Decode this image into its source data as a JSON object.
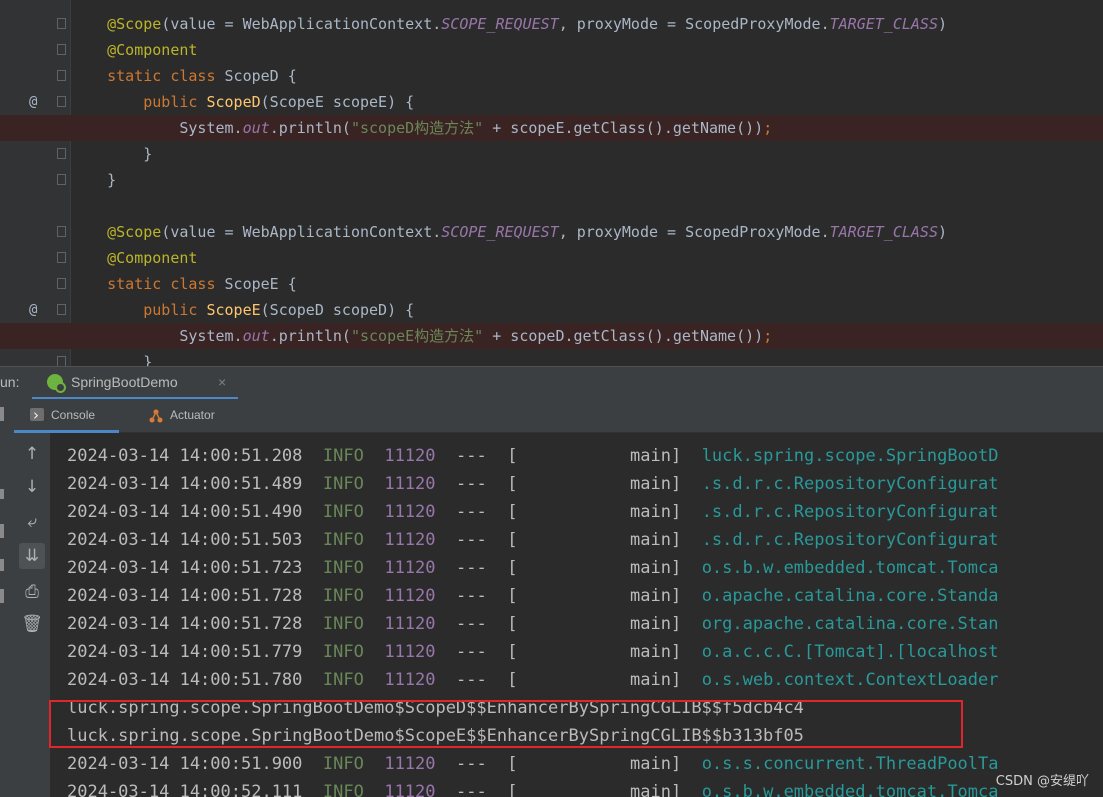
{
  "editor": {
    "lines": [
      {
        "gutter": "",
        "breakpoint": false,
        "segments": [
          {
            "c": "k-plain",
            "t": "    "
          },
          {
            "c": "k-ann",
            "t": "@Scope"
          },
          {
            "c": "k-plain",
            "t": "(value = WebApplicationContext."
          },
          {
            "c": "k-st",
            "t": "SCOPE_REQUEST"
          },
          {
            "c": "k-plain",
            "t": ", proxyMode = ScopedProxyMode."
          },
          {
            "c": "k-st",
            "t": "TARGET_CLASS"
          },
          {
            "c": "k-plain",
            "t": ")"
          }
        ]
      },
      {
        "gutter": "",
        "breakpoint": false,
        "segments": [
          {
            "c": "k-plain",
            "t": "    "
          },
          {
            "c": "k-ann",
            "t": "@Component"
          }
        ]
      },
      {
        "gutter": "",
        "breakpoint": false,
        "segments": [
          {
            "c": "k-plain",
            "t": "    "
          },
          {
            "c": "k-kw",
            "t": "static class "
          },
          {
            "c": "k-plain",
            "t": "ScopeD {"
          }
        ]
      },
      {
        "gutter": "@",
        "breakpoint": false,
        "segments": [
          {
            "c": "k-plain",
            "t": "        "
          },
          {
            "c": "k-kw",
            "t": "public "
          },
          {
            "c": "k-fn",
            "t": "ScopeD"
          },
          {
            "c": "k-plain",
            "t": "(ScopeE scopeE) {"
          }
        ]
      },
      {
        "gutter": "",
        "breakpoint": true,
        "segments": [
          {
            "c": "k-plain",
            "t": "            System."
          },
          {
            "c": "k-st",
            "t": "out"
          },
          {
            "c": "k-plain",
            "t": ".println("
          },
          {
            "c": "k-str",
            "t": "\"scopeD构造方法\""
          },
          {
            "c": "k-plain",
            "t": " + scopeE.getClass().getName())"
          },
          {
            "c": "k-kw",
            "t": ";"
          }
        ]
      },
      {
        "gutter": "",
        "breakpoint": false,
        "segments": [
          {
            "c": "k-plain",
            "t": "        }"
          }
        ]
      },
      {
        "gutter": "",
        "breakpoint": false,
        "segments": [
          {
            "c": "k-plain",
            "t": "    }"
          }
        ]
      },
      {
        "gutter": "",
        "breakpoint": false,
        "segments": []
      },
      {
        "gutter": "",
        "breakpoint": false,
        "segments": [
          {
            "c": "k-plain",
            "t": "    "
          },
          {
            "c": "k-ann",
            "t": "@Scope"
          },
          {
            "c": "k-plain",
            "t": "(value = WebApplicationContext."
          },
          {
            "c": "k-st",
            "t": "SCOPE_REQUEST"
          },
          {
            "c": "k-plain",
            "t": ", proxyMode = ScopedProxyMode."
          },
          {
            "c": "k-st",
            "t": "TARGET_CLASS"
          },
          {
            "c": "k-plain",
            "t": ")"
          }
        ]
      },
      {
        "gutter": "",
        "breakpoint": false,
        "segments": [
          {
            "c": "k-plain",
            "t": "    "
          },
          {
            "c": "k-ann",
            "t": "@Component"
          }
        ]
      },
      {
        "gutter": "",
        "breakpoint": false,
        "segments": [
          {
            "c": "k-plain",
            "t": "    "
          },
          {
            "c": "k-kw",
            "t": "static class "
          },
          {
            "c": "k-plain",
            "t": "ScopeE {"
          }
        ]
      },
      {
        "gutter": "@",
        "breakpoint": false,
        "segments": [
          {
            "c": "k-plain",
            "t": "        "
          },
          {
            "c": "k-kw",
            "t": "public "
          },
          {
            "c": "k-fn",
            "t": "ScopeE"
          },
          {
            "c": "k-plain",
            "t": "(ScopeD scopeD) {"
          }
        ]
      },
      {
        "gutter": "",
        "breakpoint": true,
        "segments": [
          {
            "c": "k-plain",
            "t": "            System."
          },
          {
            "c": "k-st",
            "t": "out"
          },
          {
            "c": "k-plain",
            "t": ".println("
          },
          {
            "c": "k-str",
            "t": "\"scopeE构造方法\""
          },
          {
            "c": "k-plain",
            "t": " + scopeD.getClass().getName())"
          },
          {
            "c": "k-kw",
            "t": ";"
          }
        ]
      },
      {
        "gutter": "",
        "breakpoint": false,
        "segments": [
          {
            "c": "k-plain",
            "t": "        }"
          }
        ]
      }
    ]
  },
  "run_panel": {
    "label": "un:",
    "tab_title": "SpringBootDemo",
    "tab_close": "×",
    "sub_tabs": {
      "console": "Console",
      "actuator": "Actuator"
    },
    "toolbar_icons": [
      "arrow-up-icon",
      "arrow-down-icon",
      "soft-wrap-icon",
      "scroll-to-end-icon",
      "print-icon",
      "trash-icon"
    ]
  },
  "console": {
    "lines": [
      {
        "type": "log",
        "time": "2024-03-14 14:00:51.208",
        "level": "INFO",
        "pid": "11120",
        "sep": "---",
        "thread": "[           main]",
        "logger": "luck.spring.scope.SpringBootD"
      },
      {
        "type": "log",
        "time": "2024-03-14 14:00:51.489",
        "level": "INFO",
        "pid": "11120",
        "sep": "---",
        "thread": "[           main]",
        "logger": ".s.d.r.c.RepositoryConfigurat"
      },
      {
        "type": "log",
        "time": "2024-03-14 14:00:51.490",
        "level": "INFO",
        "pid": "11120",
        "sep": "---",
        "thread": "[           main]",
        "logger": ".s.d.r.c.RepositoryConfigurat"
      },
      {
        "type": "log",
        "time": "2024-03-14 14:00:51.503",
        "level": "INFO",
        "pid": "11120",
        "sep": "---",
        "thread": "[           main]",
        "logger": ".s.d.r.c.RepositoryConfigurat"
      },
      {
        "type": "log",
        "time": "2024-03-14 14:00:51.723",
        "level": "INFO",
        "pid": "11120",
        "sep": "---",
        "thread": "[           main]",
        "logger": "o.s.b.w.embedded.tomcat.Tomca"
      },
      {
        "type": "log",
        "time": "2024-03-14 14:00:51.728",
        "level": "INFO",
        "pid": "11120",
        "sep": "---",
        "thread": "[           main]",
        "logger": "o.apache.catalina.core.Standa"
      },
      {
        "type": "log",
        "time": "2024-03-14 14:00:51.728",
        "level": "INFO",
        "pid": "11120",
        "sep": "---",
        "thread": "[           main]",
        "logger": "org.apache.catalina.core.Stan"
      },
      {
        "type": "log",
        "time": "2024-03-14 14:00:51.779",
        "level": "INFO",
        "pid": "11120",
        "sep": "---",
        "thread": "[           main]",
        "logger": "o.a.c.c.C.[Tomcat].[localhost"
      },
      {
        "type": "log",
        "time": "2024-03-14 14:00:51.780",
        "level": "INFO",
        "pid": "11120",
        "sep": "---",
        "thread": "[           main]",
        "logger": "o.s.web.context.ContextLoader"
      },
      {
        "type": "plain",
        "text": "luck.spring.scope.SpringBootDemo$ScopeD$$EnhancerBySpringCGLIB$$f5dcb4c4"
      },
      {
        "type": "plain",
        "text": "luck.spring.scope.SpringBootDemo$ScopeE$$EnhancerBySpringCGLIB$$b313bf05"
      },
      {
        "type": "log",
        "time": "2024-03-14 14:00:51.900",
        "level": "INFO",
        "pid": "11120",
        "sep": "---",
        "thread": "[           main]",
        "logger": "o.s.s.concurrent.ThreadPoolTa"
      },
      {
        "type": "log",
        "time": "2024-03-14 14:00:52.111",
        "level": "INFO",
        "pid": "11120",
        "sep": "---",
        "thread": "[           main]",
        "logger": "o.s.b.w.embedded.tomcat.Tomca"
      }
    ]
  },
  "watermark": "CSDN @安缇吖",
  "colors": {
    "highlight_box": "#e0262b",
    "tab_underline": "#4a88c7",
    "breakpoint": "#db5c5c"
  }
}
